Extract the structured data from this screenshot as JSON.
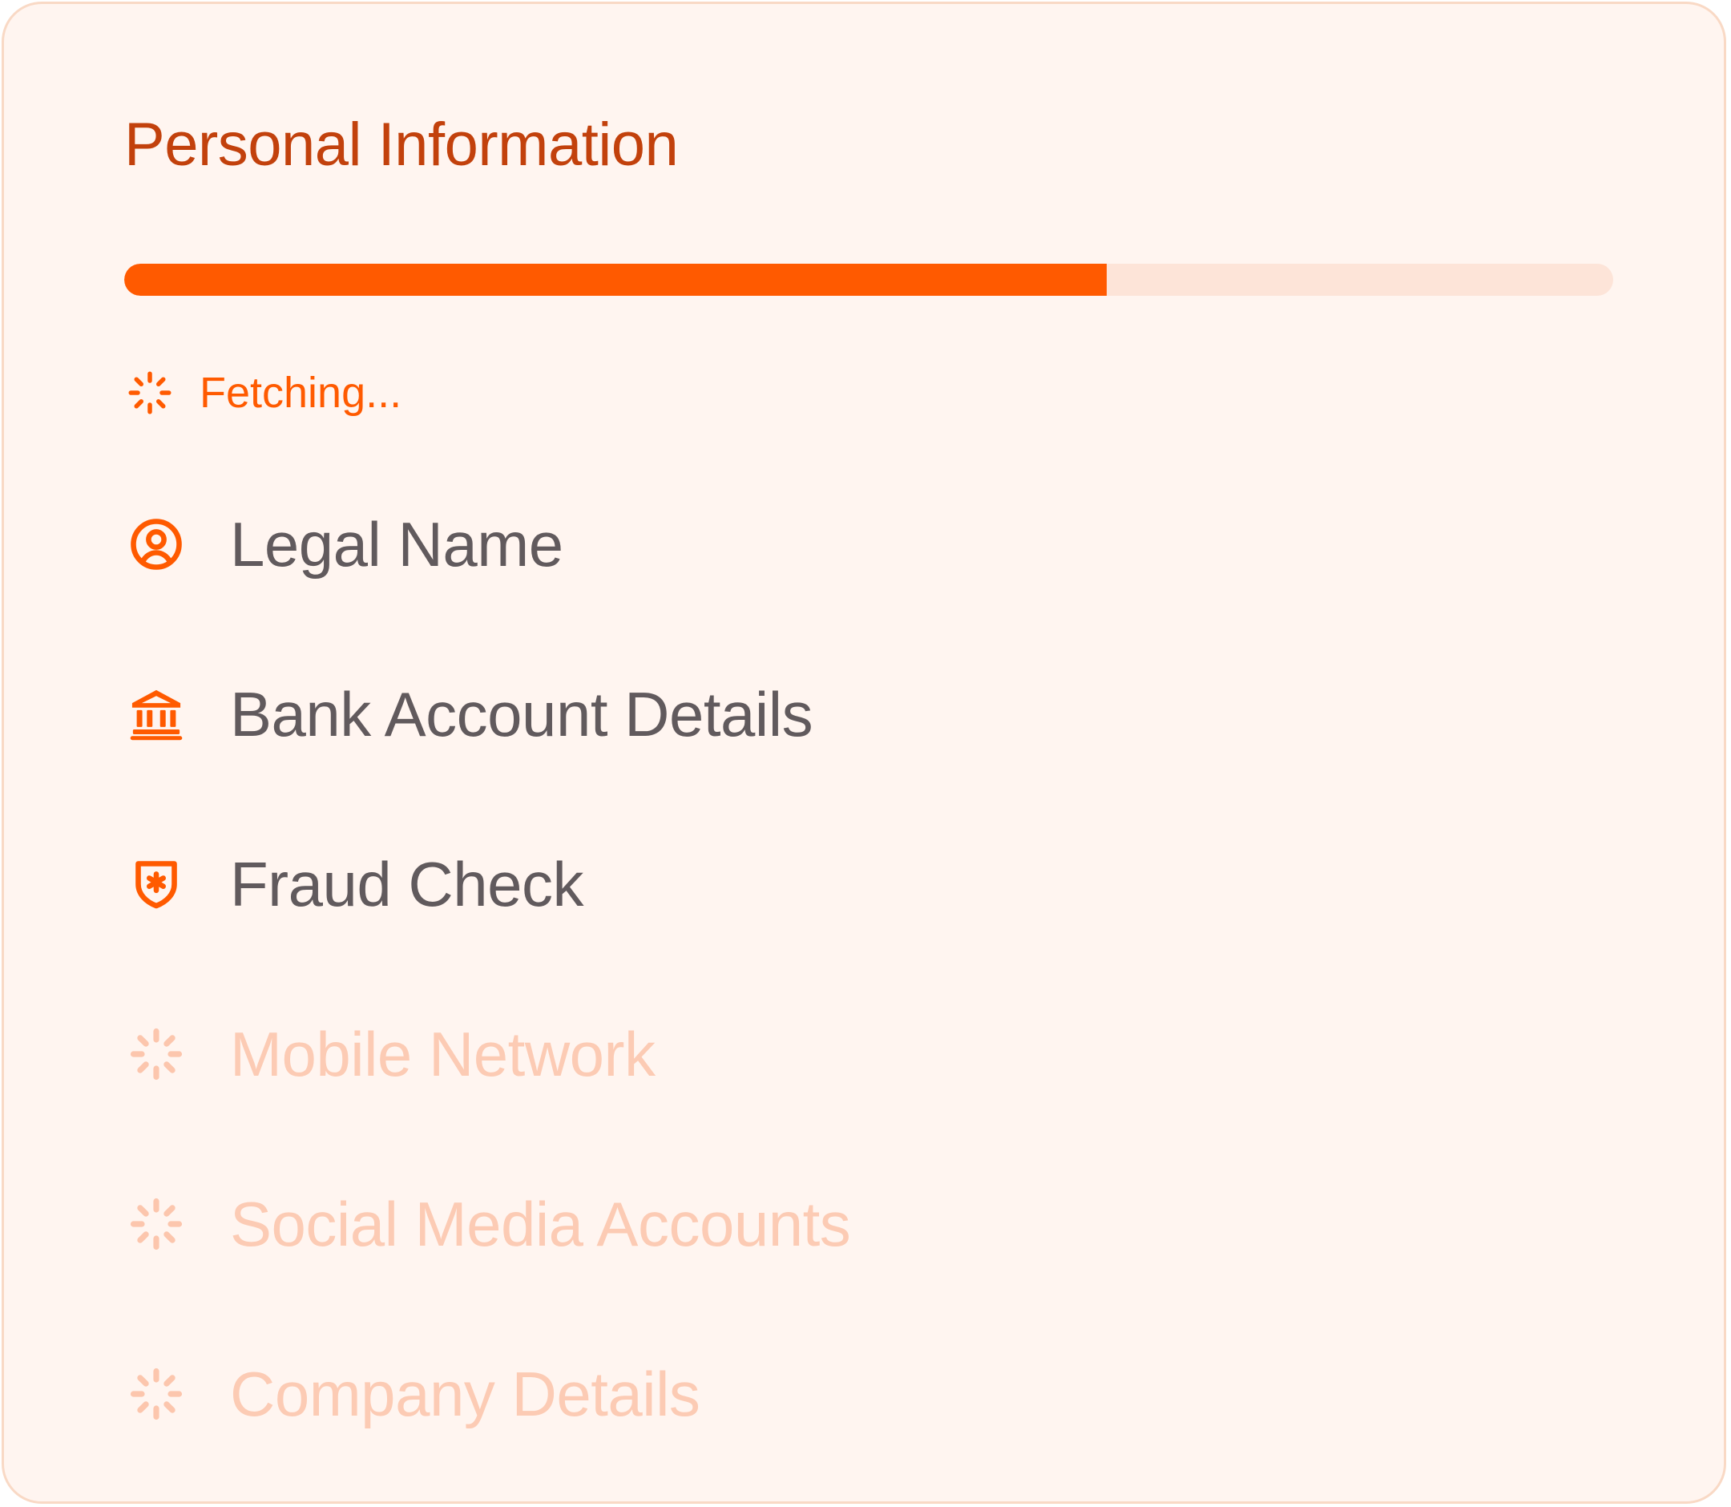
{
  "card": {
    "title": "Personal Information",
    "progress": {
      "percent": 66
    },
    "status": {
      "text": "Fetching...",
      "icon": "loader-icon"
    },
    "items": [
      {
        "label": "Legal Name",
        "icon": "user-circle-icon",
        "state": "done"
      },
      {
        "label": "Bank Account Details",
        "icon": "bank-icon",
        "state": "done"
      },
      {
        "label": "Fraud Check",
        "icon": "shield-asterisk-icon",
        "state": "done"
      },
      {
        "label": "Mobile Network",
        "icon": "loader-icon",
        "state": "pending"
      },
      {
        "label": "Social Media Accounts",
        "icon": "loader-icon",
        "state": "pending"
      },
      {
        "label": "Company Details",
        "icon": "loader-icon",
        "state": "pending"
      }
    ]
  },
  "colors": {
    "accent": "#ff5a00",
    "title": "#c2410c",
    "done_text": "#615a5d",
    "pending_text": "#fccbb4",
    "pending_icon": "#fcc6ad",
    "track": "#fde4d8",
    "background": "#fff5f0",
    "border": "#f9d9c5"
  }
}
